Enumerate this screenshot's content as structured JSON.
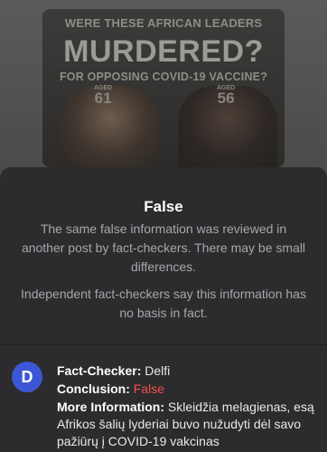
{
  "post_image": {
    "line1": "WERE THESE AFRICAN LEADERS",
    "line2": "MURDERED?",
    "line3": "FOR OPPOSING COVID-19 VACCINE?",
    "left": {
      "aged_label": "AGED",
      "aged_value": "61"
    },
    "right": {
      "aged_label": "AGED",
      "aged_value": "56"
    }
  },
  "verdict": {
    "title": "False",
    "text1": "The same false information was reviewed in another post by fact-checkers. There may be small differences.",
    "text2": "Independent fact-checkers say this information has no basis in fact."
  },
  "factcheck": {
    "avatar_letter": "D",
    "checker_label": "Fact-Checker:",
    "checker_value": "Delfi",
    "conclusion_label": "Conclusion:",
    "conclusion_value": "False",
    "more_label": "More Information:",
    "more_value": "Skleidžia melagienas, esą Afrikos šalių lyderiai buvo nužudyti dėl savo pažiūrų į COVID-19 vakcinas"
  },
  "colors": {
    "avatar_bg": "#3c57d6",
    "false_red": "#f2504b",
    "sheet_bg": "#2c2c2e"
  }
}
